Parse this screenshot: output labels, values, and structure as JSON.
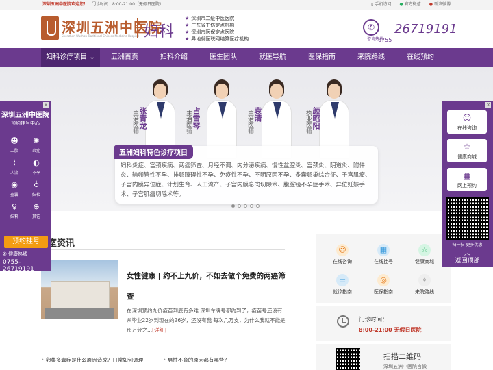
{
  "topbar": {
    "welcome": "深圳五洲中医院欢迎您！",
    "hours": "门诊时间：8:00-21:00（无假日医院）",
    "links": [
      "手机访问",
      "官方微信",
      "新浪微博"
    ]
  },
  "header": {
    "brand": "深圳五洲中医院",
    "brand_en": "Shenzhen Wuzhou Traditional Chinese Medicine Hospital",
    "dept": "妇科",
    "bullets": [
      "深圳市二级中医医院",
      "广东省工伤定点机构",
      "深圳市医保定点医院",
      "异地就医联网结算医疗机构"
    ],
    "phone_label": "咨询热线",
    "phone_prefix": "0755",
    "phone_number": "26719191"
  },
  "nav": [
    "妇科诊疗项目",
    "五洲首页",
    "妇科介绍",
    "医生团队",
    "就医导航",
    "医保指南",
    "来院路线",
    "在线预约"
  ],
  "banner": {
    "doctors": [
      {
        "title": "主治医师",
        "name": "张青龙"
      },
      {
        "title": "主治医师",
        "name": "占雪琴"
      },
      {
        "title": "主治医师",
        "name": "袁清"
      },
      {
        "title": "执业医师",
        "name": "颜昭阳"
      }
    ],
    "feature_title": "五洲妇科特色诊疗项目",
    "feature_body": "妇科炎症、宫颈疾病、两癌筛查、月经不调、内分泌疾病、慢性盆腔炎、宫颈炎、阴道炎、附件炎、输卵管性不孕、排卵障碍性不孕、免疫性不孕、不明原因不孕、多囊卵巢综合征、子宫肌瘤、子宫内膜异位症、计划生育、人工流产、子宫内膜息肉切除术、腹腔镜不孕症手术、异位妊娠手术、子宫肌瘤切除术等。"
  },
  "news": {
    "section_title": "室资讯",
    "headline": "女性健康 | 约不上九价，不如去做个免费的两癌筛查",
    "summary": "在深圳预约九价疫苗到底有多难 深圳车牌号都约到了，疫苗号还没有 从毕业22岁到现在的26岁，还没有我 每次几万支，为什么我就不能是那万分之...",
    "more": "[详细]",
    "list_left": [
      "卵巢多囊症是什么原因造成？日常如何调理"
    ],
    "list_right": [
      "男性不育的原因都有哪些？"
    ]
  },
  "services": [
    {
      "label": "在线咨询",
      "icon": "chat-icon",
      "color": "#e67e22"
    },
    {
      "label": "在线挂号",
      "icon": "calendar-icon",
      "color": "#3498db"
    },
    {
      "label": "健康商城",
      "icon": "shop-icon",
      "color": "#27ae60"
    },
    {
      "label": "就诊指南",
      "icon": "guide-icon",
      "color": "#3498db"
    },
    {
      "label": "医保指南",
      "icon": "insurance-icon",
      "color": "#e67e22"
    },
    {
      "label": "来院路线",
      "icon": "location-icon",
      "color": "#888888"
    }
  ],
  "clinic": {
    "label": "门诊时间：",
    "value": "8:00-21:00 无假日医院"
  },
  "qrcode": {
    "label": "扫描二维码",
    "sub": "深圳五洲中医院官微"
  },
  "left_float": {
    "title": "深圳五洲中医院",
    "subtitle": "预约挂号中心",
    "items": [
      "二胎",
      "炎症",
      "人流",
      "不孕",
      "查囊",
      "妇检",
      "妇科",
      "其它"
    ],
    "button": "预约挂号",
    "hotline_label": "健康热线",
    "hotline": "0755-26719191"
  },
  "right_float": {
    "cards": [
      "在线咨询",
      "健康商城",
      "网上预约"
    ],
    "qr_label": "扫一扫 更多优惠",
    "back_top": "返回顶部"
  },
  "colors": {
    "brand": "#6b3a8e",
    "accent": "#b85c2e",
    "orange": "#f39c12"
  }
}
